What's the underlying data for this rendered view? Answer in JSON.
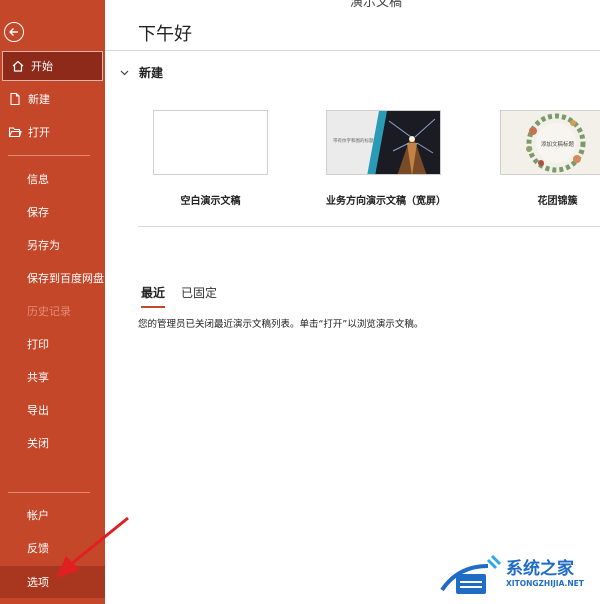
{
  "app": {
    "document_title": "演示文稿",
    "greeting": "下午好"
  },
  "sidebar": {
    "items": [
      {
        "label": "开始",
        "icon": "home-icon"
      },
      {
        "label": "新建",
        "icon": "new-document-icon"
      },
      {
        "label": "打开",
        "icon": "open-folder-icon"
      },
      {
        "label": "信息"
      },
      {
        "label": "保存"
      },
      {
        "label": "另存为"
      },
      {
        "label": "保存到百度网盘"
      },
      {
        "label": "历史记录"
      },
      {
        "label": "打印"
      },
      {
        "label": "共享"
      },
      {
        "label": "导出"
      },
      {
        "label": "关闭"
      },
      {
        "label": "帐户"
      },
      {
        "label": "反馈"
      },
      {
        "label": "选项"
      }
    ]
  },
  "new_section": {
    "title": "新建",
    "templates": [
      {
        "caption": "空白演示文稿"
      },
      {
        "caption": "业务方向演示文稿（宽屏）",
        "thumb_text": "带有纹字和图的标题"
      },
      {
        "caption": "花团锦簇",
        "thumb_text": "添加文稿标题"
      }
    ]
  },
  "recent": {
    "tabs": [
      {
        "label": "最近"
      },
      {
        "label": "已固定"
      }
    ],
    "notice": "您的管理员已关闭最近演示文稿列表。单击“打开”以浏览演示文稿。"
  },
  "watermark": {
    "title": "系统之家",
    "url": "XITONGZHIJIA.NET"
  },
  "colors": {
    "accent": "#c4472a",
    "active_nav": "#8e2a1a",
    "watermark": "#1f6cc7",
    "annotation_arrow": "#e02020"
  }
}
